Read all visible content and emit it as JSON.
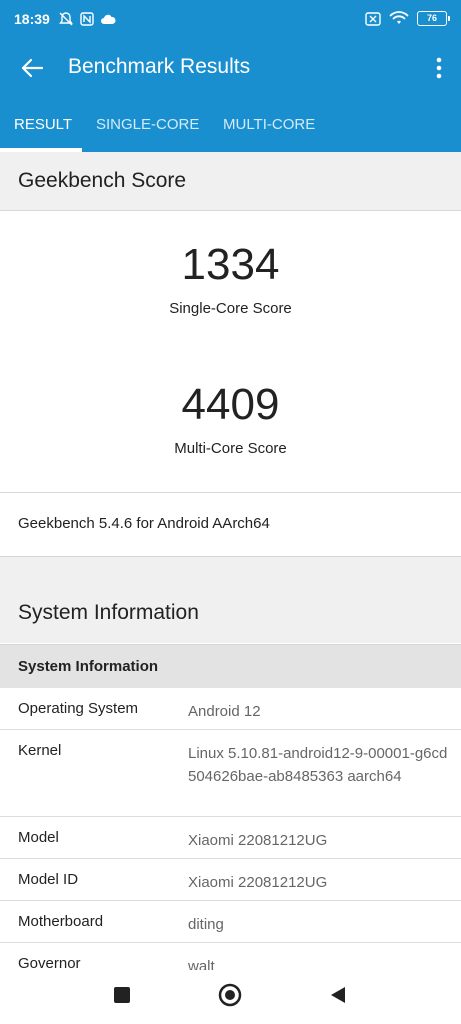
{
  "status_bar": {
    "time": "18:39",
    "battery": "76",
    "icons": [
      "notifications-off-icon",
      "nfc-icon",
      "cloud-icon",
      "sim-off-icon",
      "wifi-icon",
      "battery-icon"
    ]
  },
  "toolbar": {
    "title": "Benchmark Results",
    "back_icon": "back-arrow-icon",
    "more_icon": "more-vert-icon"
  },
  "tabs": [
    {
      "label": "RESULT",
      "active": true
    },
    {
      "label": "SINGLE-CORE",
      "active": false
    },
    {
      "label": "MULTI-CORE",
      "active": false
    }
  ],
  "geekbench": {
    "heading": "Geekbench Score",
    "single_score": "1334",
    "single_label": "Single-Core Score",
    "multi_score": "4409",
    "multi_label": "Multi-Core Score",
    "version": "Geekbench 5.4.6 for Android AArch64"
  },
  "system_info": {
    "heading": "System Information",
    "subheading": "System Information",
    "rows": [
      {
        "key": "Operating System",
        "value": "Android 12"
      },
      {
        "key": "Kernel",
        "value": "Linux 5.10.81-android12-9-00001-g6cd504626bae-ab8485363 aarch64"
      },
      {
        "key": "Model",
        "value": "Xiaomi 22081212UG"
      },
      {
        "key": "Model ID",
        "value": "Xiaomi 22081212UG"
      },
      {
        "key": "Motherboard",
        "value": "diting"
      },
      {
        "key": "Governor",
        "value": "walt"
      }
    ]
  },
  "colors": {
    "app_bar": "#1a8fd0",
    "section_bg": "#f0f0f0"
  }
}
